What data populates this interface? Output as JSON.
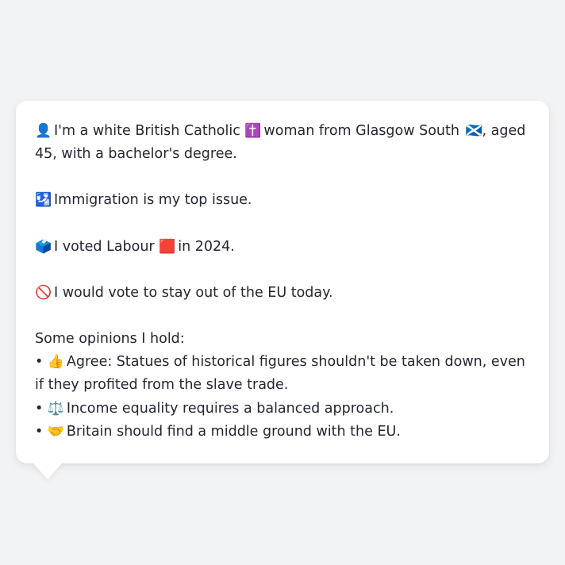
{
  "bio": {
    "identity_icon": "👤",
    "identity_text_1": "I'm a white British Catholic",
    "religion_icon": "✝️",
    "identity_text_2": "woman from Glasgow South",
    "flag_icon": "🏴󠁧󠁢󠁳󠁣󠁴󠁿",
    "identity_text_3": ", aged 45, with a bachelor's degree."
  },
  "issue": {
    "icon": "🛂",
    "text": "Immigration is my top issue."
  },
  "vote": {
    "icon": "🗳️",
    "text_1": "I voted Labour",
    "party_icon": "🟥",
    "text_2": "in 2024."
  },
  "eu": {
    "icon": "🚫",
    "text": "I would vote to stay out of the EU today."
  },
  "opinions": {
    "heading": "Some opinions I hold:",
    "items": [
      {
        "bullet": "•",
        "icon": "👍",
        "text": "Agree: Statues of historical figures shouldn't be taken down, even if they profited from the slave trade."
      },
      {
        "bullet": "•",
        "icon": "⚖️",
        "text": "Income equality requires a balanced approach."
      },
      {
        "bullet": "•",
        "icon": "🤝",
        "text": "Britain should find a middle ground with the EU."
      }
    ]
  }
}
